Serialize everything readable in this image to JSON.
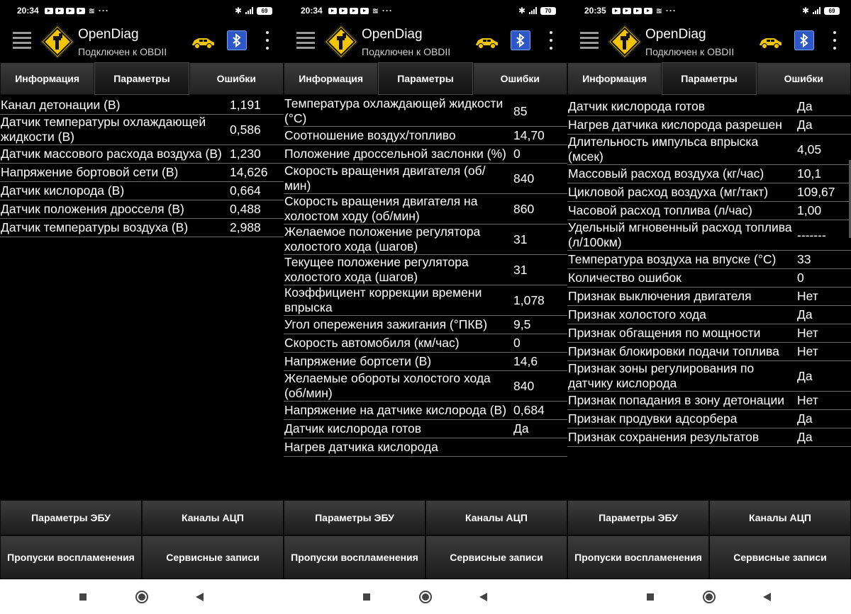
{
  "colors": {
    "background": "#000000",
    "tab_bg": "#2b2b2b",
    "bluetooth": "#2e58c7",
    "logo_yellow": "#f2c500",
    "navbar": "#ffffff"
  },
  "screens": [
    {
      "status": {
        "time": "20:34",
        "battery": "69"
      },
      "app": {
        "title": "OpenDiag",
        "subtitle": "Подключен к OBDII"
      },
      "tabs": [
        "Информация",
        "Параметры",
        "Ошибки"
      ],
      "rows": [
        {
          "name": "Канал детонации (В)",
          "value": "1,191"
        },
        {
          "name": "Датчик температуры охлаждающей жидкости (В)",
          "value": "0,586"
        },
        {
          "name": "Датчик массового расхода воздуха (В)",
          "value": "1,230"
        },
        {
          "name": "Напряжение бортовой сети (В)",
          "value": "14,626"
        },
        {
          "name": "Датчик кислорода (В)",
          "value": "0,664"
        },
        {
          "name": "Датчик положения дросселя (В)",
          "value": "0,488"
        },
        {
          "name": "Датчик температуры воздуха (В)",
          "value": "2,988"
        }
      ],
      "buttons": [
        "Параметры ЭБУ",
        "Каналы АЦП",
        "Пропуски воспламенения",
        "Сервисные записи"
      ]
    },
    {
      "status": {
        "time": "20:34",
        "battery": "70"
      },
      "app": {
        "title": "OpenDiag",
        "subtitle": "Подключен к OBDII"
      },
      "tabs": [
        "Информация",
        "Параметры",
        "Ошибки"
      ],
      "rows": [
        {
          "name": "Температура охлаждающей жидкости (°C)",
          "value": "85"
        },
        {
          "name": "Соотношение воздух/топливо",
          "value": "14,70"
        },
        {
          "name": "Положение дроссельной заслонки (%)",
          "value": "0"
        },
        {
          "name": "Скорость вращения двигателя (об/мин)",
          "value": "840"
        },
        {
          "name": "Скорость вращения двигателя на холостом ходу (об/мин)",
          "value": "860"
        },
        {
          "name": "Желаемое положение регулятора холостого хода (шагов)",
          "value": "31"
        },
        {
          "name": "Текущее положение регулятора холостого хода (шагов)",
          "value": "31"
        },
        {
          "name": "Коэффициент коррекции времени впрыска",
          "value": "1,078"
        },
        {
          "name": "Угол опережения зажигания (°ПКВ)",
          "value": "9,5"
        },
        {
          "name": "Скорость автомобиля (км/час)",
          "value": "0"
        },
        {
          "name": "Напряжение бортсети (В)",
          "value": "14,6"
        },
        {
          "name": "Желаемые обороты холостого хода (об/мин)",
          "value": "840"
        },
        {
          "name": "Напряжение на датчике кислорода (В)",
          "value": "0,684"
        },
        {
          "name": "Датчик кислорода готов",
          "value": "Да"
        },
        {
          "name": "Нагрев датчика кислорода",
          "value": ""
        }
      ],
      "buttons": [
        "Параметры ЭБУ",
        "Каналы АЦП",
        "Пропуски воспламенения",
        "Сервисные записи"
      ]
    },
    {
      "status": {
        "time": "20:35",
        "battery": "69"
      },
      "app": {
        "title": "OpenDiag",
        "subtitle": "Подключен к OBDII"
      },
      "tabs": [
        "Информация",
        "Параметры",
        "Ошибки"
      ],
      "rows": [
        {
          "name": "Датчик кислорода готов",
          "value": "Да"
        },
        {
          "name": "Нагрев датчика кислорода разрешен",
          "value": "Да"
        },
        {
          "name": "Длительность импульса впрыска (мсек)",
          "value": "4,05"
        },
        {
          "name": "Массовый расход воздуха (кг/час)",
          "value": "10,1"
        },
        {
          "name": "Цикловой расход воздуха (мг/такт)",
          "value": "109,67"
        },
        {
          "name": "Часовой расход топлива (л/час)",
          "value": "1,00"
        },
        {
          "name": "Удельный мгновенный расход топлива (л/100км)",
          "value": "-------"
        },
        {
          "name": "Температура воздуха на впуске (°C)",
          "value": "33"
        },
        {
          "name": "Количество ошибок",
          "value": "0"
        },
        {
          "name": "Признак выключения двигателя",
          "value": "Нет"
        },
        {
          "name": "Признак холостого хода",
          "value": "Да"
        },
        {
          "name": "Признак обгащения по мощности",
          "value": "Нет"
        },
        {
          "name": "Признак блокировки подачи топлива",
          "value": "Нет"
        },
        {
          "name": "Признак зоны регулирования по датчику кислорода",
          "value": "Да"
        },
        {
          "name": "Признак попадания в зону детонации",
          "value": "Нет"
        },
        {
          "name": "Признак продувки адсорбера",
          "value": "Да"
        },
        {
          "name": "Признак сохранения результатов",
          "value": "Да"
        }
      ],
      "buttons": [
        "Параметры ЭБУ",
        "Каналы АЦП",
        "Пропуски воспламенения",
        "Сервисные записи"
      ]
    }
  ]
}
